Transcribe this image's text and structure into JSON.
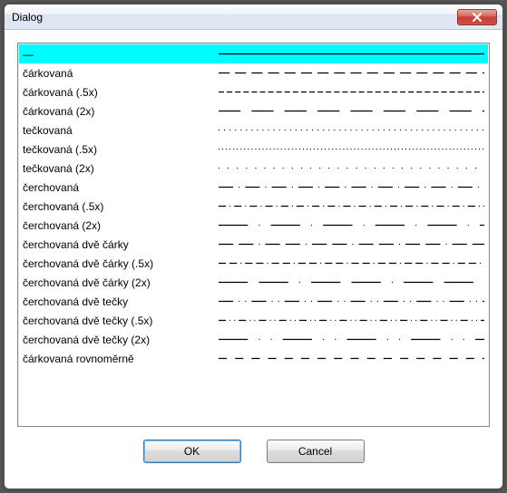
{
  "window": {
    "title": "Dialog"
  },
  "list": {
    "selected_index": 0,
    "items": [
      {
        "label": "—",
        "dasharray": ""
      },
      {
        "label": "čárkovaná",
        "dasharray": "12 6"
      },
      {
        "label": "čárkovaná (.5x)",
        "dasharray": "6 3"
      },
      {
        "label": "čárkovaná (2x)",
        "dasharray": "24 12"
      },
      {
        "label": "tečkovaná",
        "dasharray": "1 5"
      },
      {
        "label": "tečkovaná (.5x)",
        "dasharray": "1 3"
      },
      {
        "label": "tečkovaná (2x)",
        "dasharray": "1 9"
      },
      {
        "label": "čerchovaná",
        "dasharray": "16 6 1 6"
      },
      {
        "label": "čerchovaná (.5x)",
        "dasharray": "8 4 1 4"
      },
      {
        "label": "čerchovaná (2x)",
        "dasharray": "32 12 1 12"
      },
      {
        "label": "čerchovaná dvě čárky",
        "dasharray": "16 6 16 6 1 6"
      },
      {
        "label": "čerchovaná dvě čárky (.5x)",
        "dasharray": "8 4 8 4 1 4"
      },
      {
        "label": "čerchovaná dvě čárky (2x)",
        "dasharray": "32 12 32 12 1 12"
      },
      {
        "label": "čerchovaná dvě tečky",
        "dasharray": "16 6 1 6 1 6"
      },
      {
        "label": "čerchovaná dvě tečky (.5x)",
        "dasharray": "8 4 1 4 1 4"
      },
      {
        "label": "čerchovaná dvě tečky (2x)",
        "dasharray": "32 12 1 12 1 12"
      },
      {
        "label": "čárkovaná rovnoměrně",
        "dasharray": "9 9"
      }
    ]
  },
  "buttons": {
    "ok": "OK",
    "cancel": "Cancel"
  }
}
